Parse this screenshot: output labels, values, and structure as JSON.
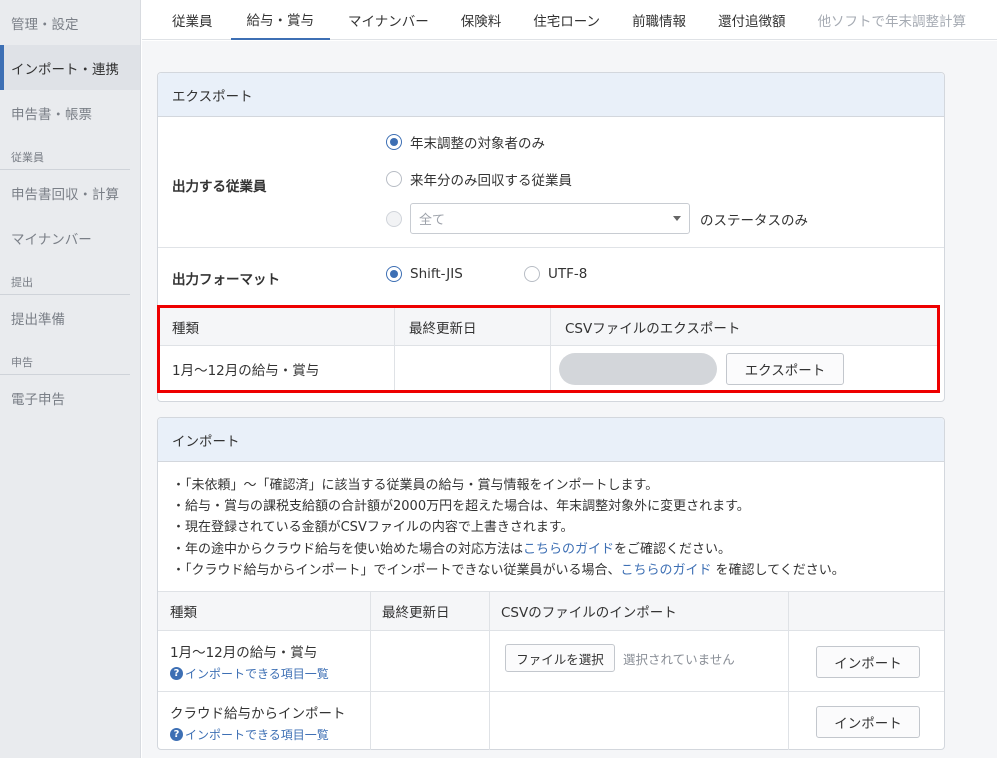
{
  "sidebar": {
    "items_top": [
      "管理・設定",
      "インポート・連携",
      "申告書・帳票"
    ],
    "section_employee": "従業員",
    "items_employee": [
      "申告書回収・計算",
      "マイナンバー"
    ],
    "section_submit": "提出",
    "items_submit": [
      "提出準備"
    ],
    "section_declare": "申告",
    "items_declare": [
      "電子申告"
    ]
  },
  "tabs": [
    "従業員",
    "給与・賞与",
    "マイナンバー",
    "保険料",
    "住宅ローン",
    "前職情報",
    "還付追徴額",
    "他ソフトで年末調整計算"
  ],
  "export": {
    "title": "エクスポート",
    "employee_label": "出力する従業員",
    "option1": "年末調整の対象者のみ",
    "option2": "来年分のみ回収する従業員",
    "select_value": "全て",
    "status_suffix": "のステータスのみ",
    "format_label": "出力フォーマット",
    "format1": "Shift-JIS",
    "format2": "UTF-8",
    "table": {
      "headers": [
        "種類",
        "最終更新日",
        "CSVファイルのエクスポート"
      ],
      "row_type": "1月〜12月の給与・賞与",
      "row_date": "",
      "button": "エクスポート"
    }
  },
  "import": {
    "title": "インポート",
    "note1": "・「未依頼」〜「確認済」に該当する従業員の給与・賞与情報をインポートします。",
    "note2": "・給与・賞与の課税支給額の合計額が2000万円を超えた場合は、年末調整対象外に変更されます。",
    "note3": "・現在登録されている金額がCSVファイルの内容で上書きされます。",
    "note4_pre": "・年の途中からクラウド給与を使い始めた場合の対応方法は",
    "note4_link": "こちらのガイド",
    "note4_post": "をご確認ください。",
    "note5_pre": "・「クラウド給与からインポート」でインポートできない従業員がいる場合、",
    "note5_link": "こちらのガイド",
    "note5_post": "を確認してください。",
    "table": {
      "headers": [
        "種類",
        "最終更新日",
        "CSVのファイルのインポート",
        ""
      ],
      "row1_type": "1月〜12月の給与・賞与",
      "row1_help": "インポートできる項目一覧",
      "file_button": "ファイルを選択",
      "file_status": "選択されていません",
      "row2_type": "クラウド給与からインポート",
      "row2_help": "インポートできる項目一覧",
      "import_button": "インポート"
    }
  }
}
